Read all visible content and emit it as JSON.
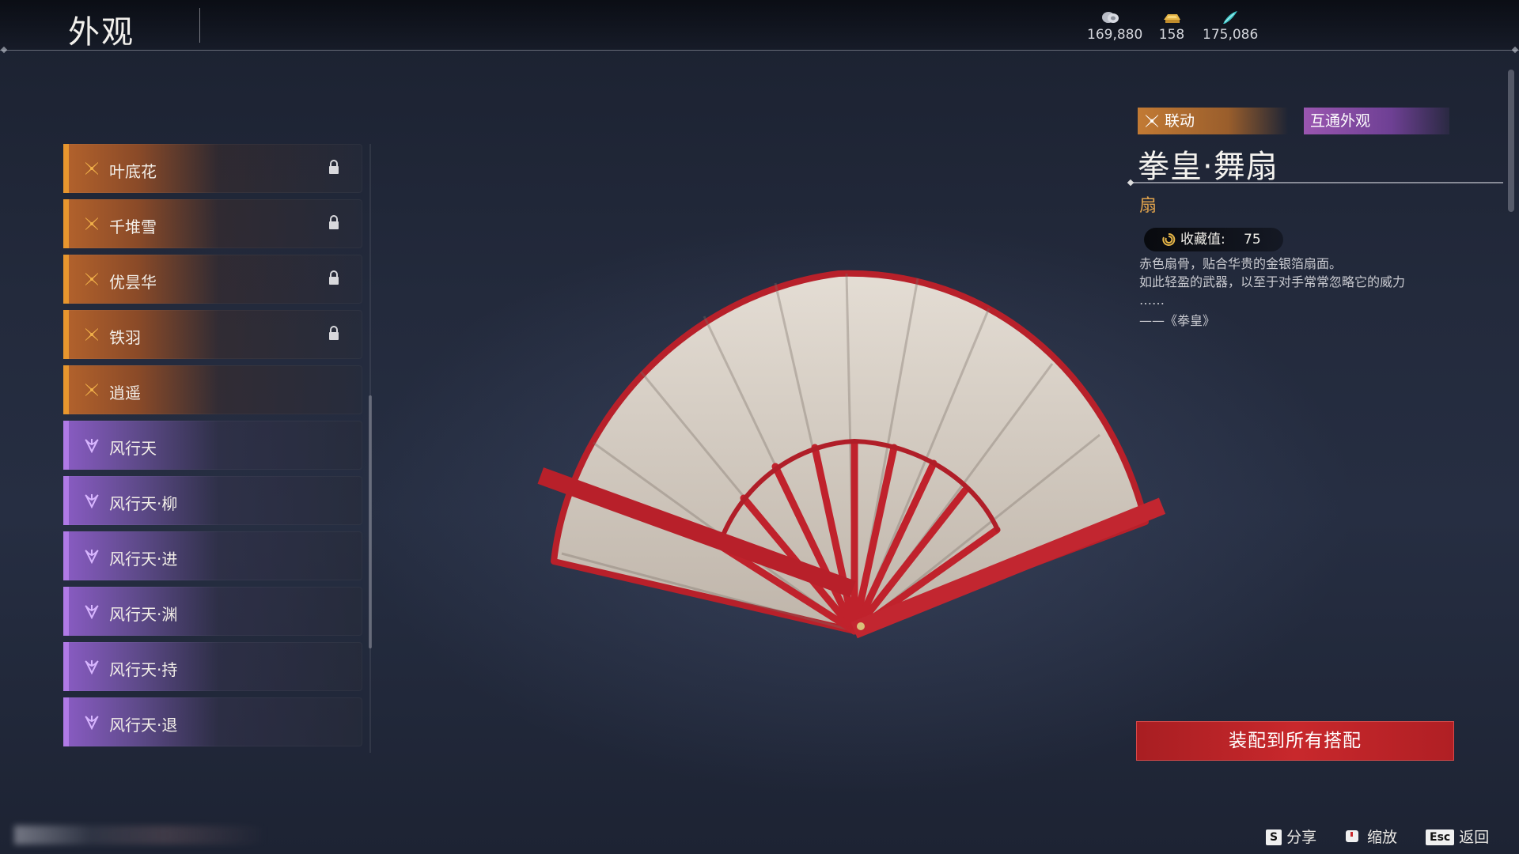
{
  "header": {
    "title": "外观",
    "currencies": [
      {
        "icon": "silver-coin-icon",
        "value": "169,880"
      },
      {
        "icon": "gold-ingot-icon",
        "value": "158"
      },
      {
        "icon": "jade-feather-icon",
        "value": "175,086"
      }
    ]
  },
  "list": {
    "items": [
      {
        "label": "叶底花",
        "rarity": "orange",
        "icon": "collab-star-icon",
        "locked": true
      },
      {
        "label": "千堆雪",
        "rarity": "orange",
        "icon": "collab-star-icon",
        "locked": true
      },
      {
        "label": "优昙华",
        "rarity": "orange",
        "icon": "collab-star-icon",
        "locked": true
      },
      {
        "label": "铁羽",
        "rarity": "orange",
        "icon": "collab-star-icon",
        "locked": true
      },
      {
        "label": "逍遥",
        "rarity": "orange",
        "icon": "collab-star-icon",
        "locked": false
      },
      {
        "label": "风行天",
        "rarity": "purple",
        "icon": "purple-flower-icon",
        "locked": false
      },
      {
        "label": "风行天·柳",
        "rarity": "purple",
        "icon": "purple-flower-icon",
        "locked": false
      },
      {
        "label": "风行天·进",
        "rarity": "purple",
        "icon": "purple-flower-icon",
        "locked": false
      },
      {
        "label": "风行天·渊",
        "rarity": "purple",
        "icon": "purple-flower-icon",
        "locked": false
      },
      {
        "label": "风行天·持",
        "rarity": "purple",
        "icon": "purple-flower-icon",
        "locked": false
      },
      {
        "label": "风行天·退",
        "rarity": "purple",
        "icon": "purple-flower-icon",
        "locked": false
      }
    ]
  },
  "detail": {
    "tag_collab": "联动",
    "tag_shared": "互通外观",
    "name": "拳皇·舞扇",
    "type": "扇",
    "collect_label": "收藏值:",
    "collect_value": "75",
    "desc_line1": "赤色扇骨，贴合华贵的金银箔扇面。",
    "desc_line2": "如此轻盈的武器，以至于对手常常忽略它的威力",
    "desc_line3": "……",
    "source": "——《拳皇》"
  },
  "equip_button": "装配到所有搭配",
  "hints": {
    "share_key": "S",
    "share_label": "分享",
    "zoom_label": "缩放",
    "back_key": "Esc",
    "back_label": "返回"
  },
  "colors": {
    "orange": "#e8962e",
    "purple": "#b07ae6",
    "accent_red": "#c8282c",
    "type_gold": "#e0a34c"
  }
}
